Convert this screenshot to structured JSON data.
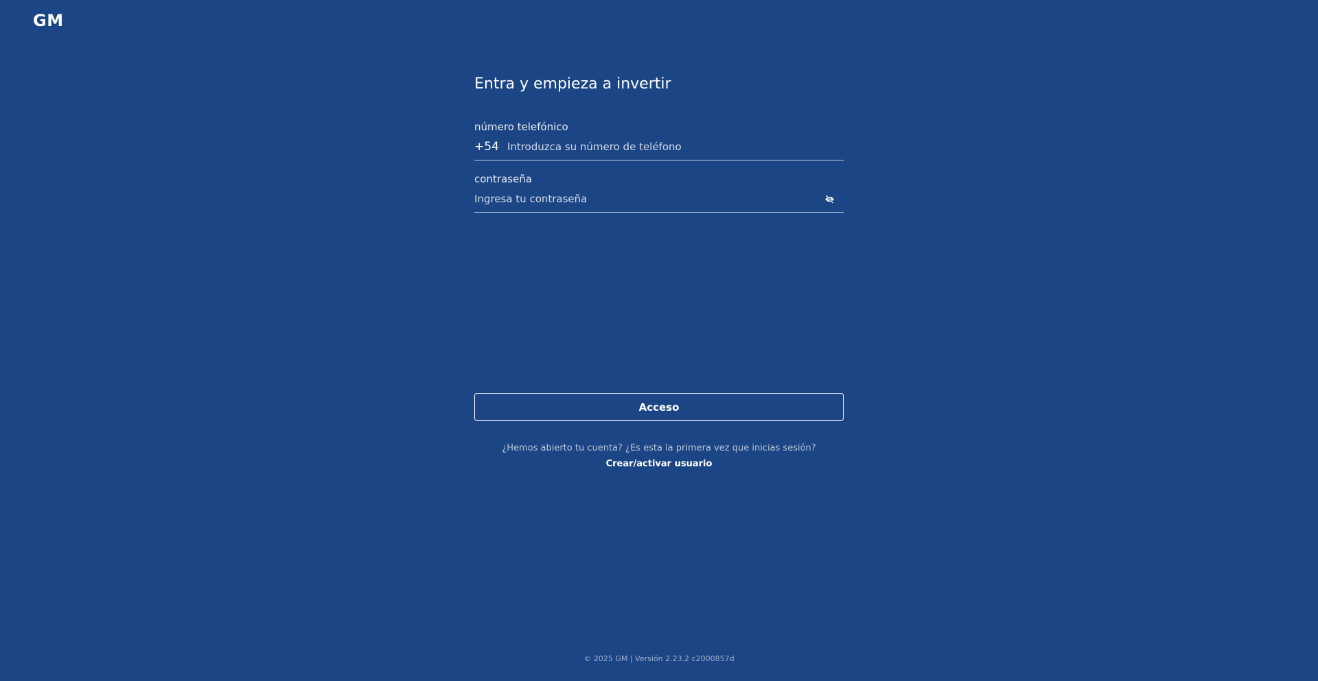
{
  "brand": {
    "logo_text": "GM"
  },
  "login": {
    "title": "Entra y empieza a invertir",
    "phone": {
      "label": "número telefónico",
      "prefix": "+54",
      "placeholder": "Introduzca su número de teléfono",
      "value": ""
    },
    "password": {
      "label": "contraseña",
      "placeholder": "Ingresa tu contraseña",
      "value": "",
      "toggle_icon": "eye-slash-icon"
    },
    "submit_label": "Acceso"
  },
  "help": {
    "text": "¿Hemos abierto tu cuenta? ¿Es esta la primera vez que inicias sesión?",
    "link_label": "Crear/activar usuario"
  },
  "footer": {
    "text": "© 2025 GM | Versión 2.23.2 c2000857d"
  },
  "colors": {
    "background": "#1b4584",
    "text": "#ffffff",
    "muted_text": "#b7c4d9"
  }
}
